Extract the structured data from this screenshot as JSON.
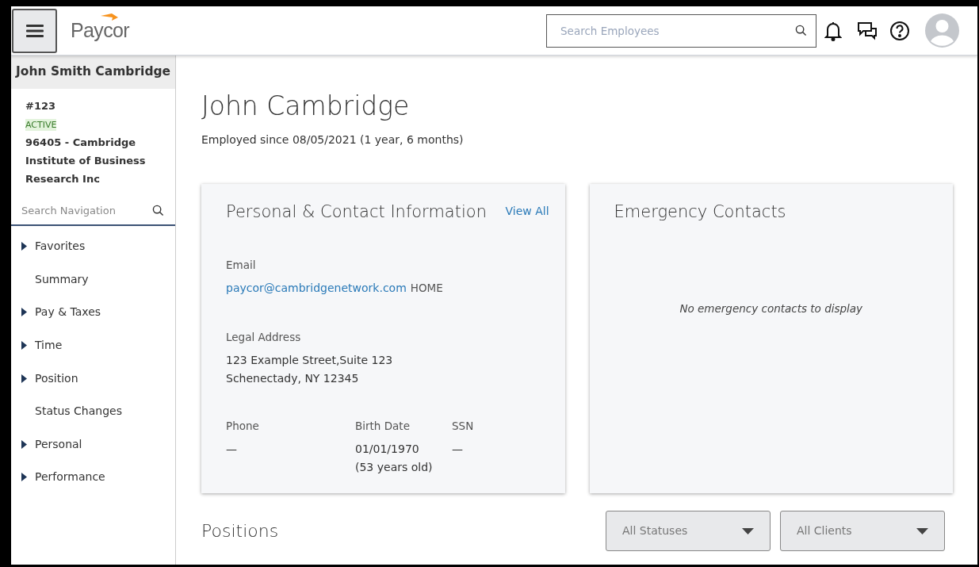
{
  "header": {
    "logo": "Paycor",
    "search": {
      "placeholder": "Search Employees"
    }
  },
  "sidebar": {
    "employee_name": "John Smith Cambridge",
    "employee_number": "#123",
    "status": "ACTIVE",
    "company": "96405 - Cambridge Institute of Business Research Inc",
    "search": {
      "placeholder": "Search Navigation"
    },
    "items": [
      {
        "label": "Favorites",
        "kind": "group"
      },
      {
        "label": "Summary",
        "kind": "link"
      },
      {
        "label": "Pay & Taxes",
        "kind": "group"
      },
      {
        "label": "Time",
        "kind": "group"
      },
      {
        "label": "Position",
        "kind": "group"
      },
      {
        "label": "Status Changes",
        "kind": "link"
      },
      {
        "label": "Personal",
        "kind": "group"
      },
      {
        "label": "Performance",
        "kind": "group"
      }
    ]
  },
  "main": {
    "title": "John Cambridge",
    "subtitle": "Employed since 08/05/2021 (1 year, 6 months)",
    "personal_card": {
      "title": "Personal & Contact Information",
      "link": "View All",
      "email_label": "Email",
      "email": "paycor@cambridgenetwork.com",
      "email_type": "HOME",
      "address_label": "Legal Address",
      "address_lines": [
        "123 Example Street,Suite 123",
        "Schenectady, NY 12345"
      ],
      "fields": [
        {
          "label": "Phone",
          "lines": [
            "—"
          ]
        },
        {
          "label": "Birth Date",
          "lines": [
            "01/01/1970",
            "(53 years old)"
          ]
        },
        {
          "label": "SSN",
          "lines": [
            "—"
          ]
        }
      ]
    },
    "emergency_card": {
      "title": "Emergency Contacts",
      "empty_message": "No emergency contacts to display"
    },
    "positions": {
      "title": "Positions",
      "filters": [
        "All Statuses",
        "All Clients"
      ]
    }
  }
}
